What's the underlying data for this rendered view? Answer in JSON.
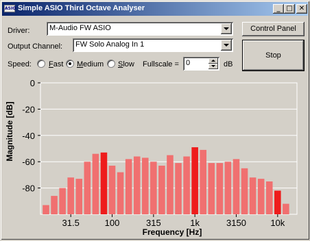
{
  "window": {
    "icon_text": "ASIO",
    "title": "Simple ASIO Third Octave Analyser",
    "minimize_glyph": "_",
    "maximize_glyph": "□",
    "close_glyph": "✕"
  },
  "driver": {
    "label": "Driver:",
    "value": "M-Audio FW ASIO"
  },
  "output_channel": {
    "label": "Output Channel:",
    "value": "FW Solo Analog In 1"
  },
  "speed": {
    "label": "Speed:",
    "options": [
      {
        "key": "F",
        "rest": "ast",
        "checked": false
      },
      {
        "key": "M",
        "rest": "edium",
        "checked": true
      },
      {
        "key": "S",
        "rest": "low",
        "checked": false
      }
    ]
  },
  "fullscale": {
    "label": "Fullscale =",
    "value": "0",
    "unit": "dB"
  },
  "buttons": {
    "control_panel": "Control Panel",
    "stop": "Stop"
  },
  "colors": {
    "bar_normal": "#f07070",
    "bar_highlight": "#ee1c1c",
    "plot_bg": "#d4d0c8",
    "gridline": "#ffffff"
  },
  "chart_data": {
    "type": "bar",
    "xlabel": "Frequency [Hz]",
    "ylabel": "Magnitude [dB]",
    "ylim": [
      -100,
      0
    ],
    "yticks": [
      0,
      -20,
      -40,
      -60,
      -80
    ],
    "grid": "horizontal",
    "x_tick_labels": [
      {
        "label": "31.5",
        "band": 3
      },
      {
        "label": "100",
        "band": 8
      },
      {
        "label": "315",
        "band": 13
      },
      {
        "label": "1k",
        "band": 18
      },
      {
        "label": "3150",
        "band": 23
      },
      {
        "label": "10k",
        "band": 28
      }
    ],
    "bands": 31,
    "values": [
      -93,
      -86,
      -80,
      -72,
      -73,
      -60,
      -54,
      -53,
      -63,
      -68,
      -58,
      -56,
      -57,
      -60,
      -63,
      -55,
      -61,
      -56,
      -49,
      -51,
      -61,
      -61,
      -60,
      -58,
      -65,
      -72,
      -73,
      -75,
      -82,
      -92,
      -100
    ],
    "highlight": [
      7,
      18,
      28
    ]
  }
}
